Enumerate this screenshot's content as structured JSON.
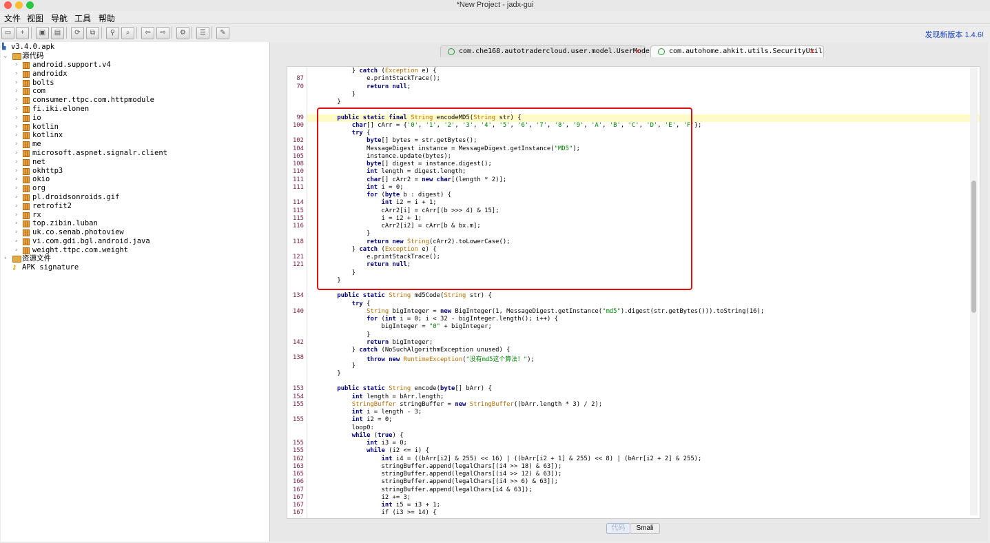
{
  "window": {
    "title": "*New Project - jadx-gui"
  },
  "menu": [
    "文件",
    "视图",
    "导航",
    "工具",
    "帮助"
  ],
  "toolbar": {
    "update_link": "发现新版本 1.4.6!",
    "buttons": [
      "open-file-icon",
      "add-files-icon",
      "save-all-icon",
      "export-icon",
      "sync-icon",
      "flatten-icon",
      "search-icon",
      "find-usage-icon",
      "back-icon",
      "forward-icon",
      "decompile-all-icon",
      "log-icon",
      "preferences-icon"
    ]
  },
  "tree": {
    "root": "v3.4.0.apk",
    "source_node": "源代码",
    "packages": [
      "android.support.v4",
      "androidx",
      "bolts",
      "com",
      "consumer.ttpc.com.httpmodule",
      "fi.iki.elonen",
      "io",
      "kotlin",
      "kotlinx",
      "me",
      "microsoft.aspnet.signalr.client",
      "net",
      "okhttp3",
      "okio",
      "org",
      "pl.droidsonroids.gif",
      "retrofit2",
      "rx",
      "top.zibin.luban",
      "uk.co.senab.photoview",
      "vi.com.gdi.bgl.android.java",
      "weight.ttpc.com.weight"
    ],
    "resources_node": "资源文件",
    "signature_node": "APK signature"
  },
  "tabs": [
    {
      "label": "com.che168.autotradercloud.user.model.UserModel",
      "active": false
    },
    {
      "label": "com.autohome.ahkit.utils.SecurityUtil",
      "active": true
    }
  ],
  "bottom_tabs": {
    "code": "代码",
    "smali": "Smali"
  },
  "code_lines": [
    {
      "ln": "",
      "t": "        } catch (Exception e) {"
    },
    {
      "ln": "87",
      "t": "            e.printStackTrace();"
    },
    {
      "ln": "70",
      "t": "            return null;"
    },
    {
      "ln": "",
      "t": "        }"
    },
    {
      "ln": "",
      "t": "    }"
    },
    {
      "ln": "",
      "t": ""
    },
    {
      "ln": "99",
      "t": "    public static final String encodeMD5(String str) {"
    },
    {
      "ln": "100",
      "t": "        char[] cArr = {'0', '1', '2', '3', '4', '5', '6', '7', '8', '9', 'A', 'B', 'C', 'D', 'E', 'F'};"
    },
    {
      "ln": "",
      "t": "        try {"
    },
    {
      "ln": "102",
      "t": "            byte[] bytes = str.getBytes();"
    },
    {
      "ln": "104",
      "t": "            MessageDigest instance = MessageDigest.getInstance(\"MD5\");"
    },
    {
      "ln": "105",
      "t": "            instance.update(bytes);"
    },
    {
      "ln": "108",
      "t": "            byte[] digest = instance.digest();"
    },
    {
      "ln": "110",
      "t": "            int length = digest.length;"
    },
    {
      "ln": "111",
      "t": "            char[] cArr2 = new char[(length * 2)];"
    },
    {
      "ln": "111",
      "t": "            int i = 0;"
    },
    {
      "ln": "",
      "t": "            for (byte b : digest) {"
    },
    {
      "ln": "114",
      "t": "                int i2 = i + 1;"
    },
    {
      "ln": "115",
      "t": "                cArr2[i] = cArr[(b >>> 4) & 15];"
    },
    {
      "ln": "115",
      "t": "                i = i2 + 1;"
    },
    {
      "ln": "116",
      "t": "                cArr2[i2] = cArr[b & bx.m];"
    },
    {
      "ln": "",
      "t": "            }"
    },
    {
      "ln": "118",
      "t": "            return new String(cArr2).toLowerCase();"
    },
    {
      "ln": "",
      "t": "        } catch (Exception e) {"
    },
    {
      "ln": "121",
      "t": "            e.printStackTrace();"
    },
    {
      "ln": "121",
      "t": "            return null;"
    },
    {
      "ln": "",
      "t": "        }"
    },
    {
      "ln": "",
      "t": "    }"
    },
    {
      "ln": "",
      "t": ""
    },
    {
      "ln": "134",
      "t": "    public static String md5Code(String str) {"
    },
    {
      "ln": "",
      "t": "        try {"
    },
    {
      "ln": "140",
      "t": "            String bigInteger = new BigInteger(1, MessageDigest.getInstance(\"md5\").digest(str.getBytes())).toString(16);"
    },
    {
      "ln": "",
      "t": "            for (int i = 0; i < 32 - bigInteger.length(); i++) {"
    },
    {
      "ln": "",
      "t": "                bigInteger = \"0\" + bigInteger;"
    },
    {
      "ln": "",
      "t": "            }"
    },
    {
      "ln": "142",
      "t": "            return bigInteger;"
    },
    {
      "ln": "",
      "t": "        } catch (NoSuchAlgorithmException unused) {"
    },
    {
      "ln": "138",
      "t": "            throw new RuntimeException(\"没有md5这个算法！\");"
    },
    {
      "ln": "",
      "t": "        }"
    },
    {
      "ln": "",
      "t": "    }"
    },
    {
      "ln": "",
      "t": ""
    },
    {
      "ln": "153",
      "t": "    public static String encode(byte[] bArr) {"
    },
    {
      "ln": "154",
      "t": "        int length = bArr.length;"
    },
    {
      "ln": "155",
      "t": "        StringBuffer stringBuffer = new StringBuffer((bArr.length * 3) / 2);"
    },
    {
      "ln": "",
      "t": "        int i = length - 3;"
    },
    {
      "ln": "155",
      "t": "        int i2 = 0;"
    },
    {
      "ln": "",
      "t": "        loop0:"
    },
    {
      "ln": "",
      "t": "        while (true) {"
    },
    {
      "ln": "155",
      "t": "            int i3 = 0;"
    },
    {
      "ln": "155",
      "t": "            while (i2 <= i) {"
    },
    {
      "ln": "162",
      "t": "                int i4 = ((bArr[i2] & 255) << 16) | ((bArr[i2 + 1] & 255) << 8) | (bArr[i2 + 2] & 255);"
    },
    {
      "ln": "163",
      "t": "                stringBuffer.append(legalChars[(i4 >> 18) & 63]);"
    },
    {
      "ln": "165",
      "t": "                stringBuffer.append(legalChars[(i4 >> 12) & 63]);"
    },
    {
      "ln": "166",
      "t": "                stringBuffer.append(legalChars[(i4 >> 6) & 63]);"
    },
    {
      "ln": "167",
      "t": "                stringBuffer.append(legalChars[i4 & 63]);"
    },
    {
      "ln": "167",
      "t": "                i2 += 3;"
    },
    {
      "ln": "167",
      "t": "                int i5 = i3 + 1;"
    },
    {
      "ln": "167",
      "t": "                if (i3 >= 14) {"
    }
  ],
  "colors": {
    "keyword": "#000080",
    "type": "#b86c00",
    "string": "#008000",
    "highlight_box": "#e01010",
    "current_line": "#fffbc6"
  }
}
